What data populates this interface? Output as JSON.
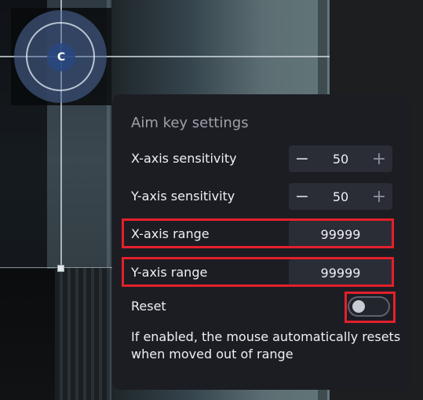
{
  "joystick": {
    "label": "C"
  },
  "panel": {
    "title": "Aim key settings",
    "x_sensitivity": {
      "label": "X-axis sensitivity",
      "value": "50",
      "minus": "−",
      "plus": "+"
    },
    "y_sensitivity": {
      "label": "Y-axis sensitivity",
      "value": "50",
      "minus": "−",
      "plus": "+"
    },
    "x_range": {
      "label": "X-axis range",
      "value": "99999"
    },
    "y_range": {
      "label": "Y-axis range",
      "value": "99999"
    },
    "reset": {
      "label": "Reset",
      "enabled": false
    },
    "description": "If enabled, the mouse automatically resets when moved out of range"
  },
  "colors": {
    "highlight": "#e3202b",
    "panel_bg": "#1c1d23"
  }
}
